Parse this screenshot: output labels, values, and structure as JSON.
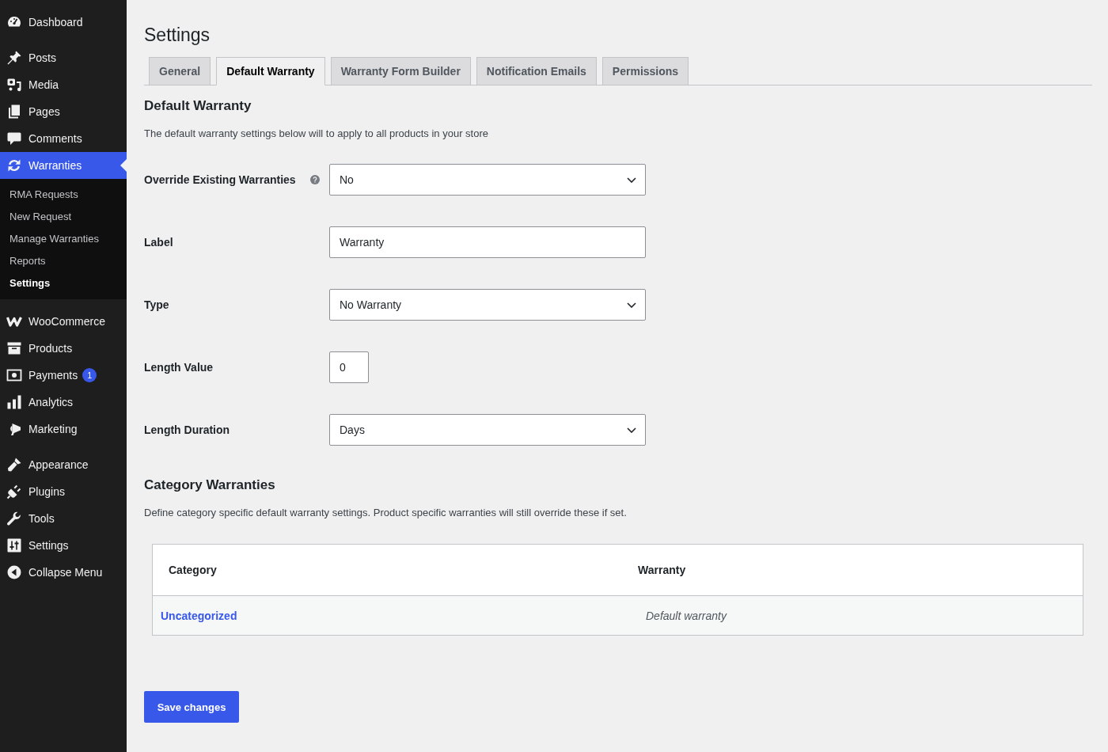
{
  "sidebar": {
    "sections": [
      {
        "items": [
          {
            "label": "Dashboard",
            "selected": false
          }
        ]
      },
      {
        "items": [
          {
            "label": "Posts",
            "selected": false
          },
          {
            "label": "Media",
            "selected": false
          },
          {
            "label": "Pages",
            "selected": false
          },
          {
            "label": "Comments",
            "selected": false
          },
          {
            "label": "Warranties",
            "selected": true,
            "children": [
              {
                "label": "RMA Requests",
                "selected": false
              },
              {
                "label": "New Request",
                "selected": false
              },
              {
                "label": "Manage Warranties",
                "selected": false
              },
              {
                "label": "Reports",
                "selected": false
              },
              {
                "label": "Settings",
                "selected": true
              }
            ]
          }
        ]
      },
      {
        "items": [
          {
            "label": "WooCommerce",
            "selected": false
          },
          {
            "label": "Products",
            "selected": false
          },
          {
            "label": "Payments",
            "selected": false,
            "badge": "1"
          },
          {
            "label": "Analytics",
            "selected": false
          },
          {
            "label": "Marketing",
            "selected": false
          }
        ]
      },
      {
        "items": [
          {
            "label": "Appearance",
            "selected": false
          },
          {
            "label": "Plugins",
            "selected": false
          },
          {
            "label": "Tools",
            "selected": false
          },
          {
            "label": "Settings",
            "selected": false
          },
          {
            "label": "Collapse Menu",
            "selected": false
          }
        ]
      }
    ]
  },
  "page": {
    "title": "Settings"
  },
  "tabs": [
    {
      "label": "General",
      "selected": false
    },
    {
      "label": "Default Warranty",
      "selected": true
    },
    {
      "label": "Warranty Form Builder",
      "selected": false
    },
    {
      "label": "Notification Emails",
      "selected": false
    },
    {
      "label": "Permissions",
      "selected": false
    }
  ],
  "default_warranty": {
    "heading": "Default Warranty",
    "description": "The default warranty settings below will to apply to all products in your store",
    "fields": [
      {
        "label": "Override Existing Warranties",
        "kind": "select",
        "value": "No",
        "help": true
      },
      {
        "label": "Label",
        "kind": "text",
        "value": "Warranty"
      },
      {
        "label": "Type",
        "kind": "select",
        "value": "No Warranty"
      },
      {
        "label": "Length Value",
        "kind": "number",
        "value": "0"
      },
      {
        "label": "Length Duration",
        "kind": "select",
        "value": "Days"
      }
    ]
  },
  "category_warranties": {
    "heading": "Category Warranties",
    "description": "Define category specific default warranty settings. Product specific warranties will still override these if set.",
    "table": {
      "columns": [
        "Category",
        "Warranty"
      ],
      "rows": [
        {
          "category": "Uncategorized",
          "warranty": "Default warranty"
        }
      ]
    }
  },
  "save_button": {
    "label": "Save changes"
  }
}
